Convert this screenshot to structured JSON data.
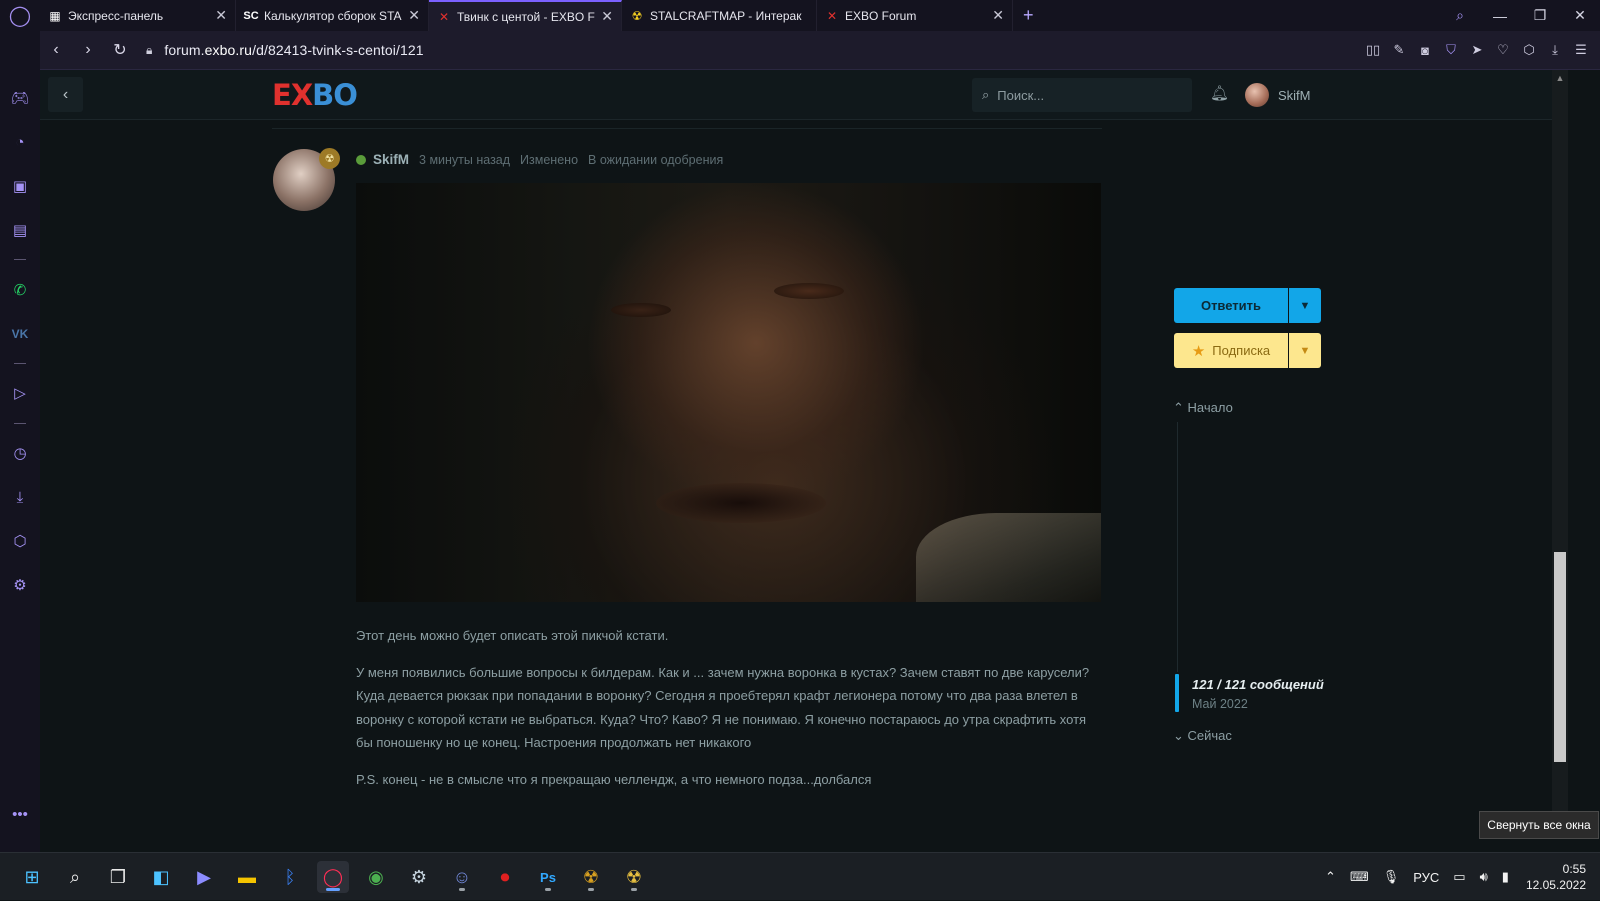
{
  "tabs": [
    {
      "title": "Экспресс-панель",
      "icon": "grid-icon",
      "active": false
    },
    {
      "title": "Калькулятор сборок STALC",
      "icon": "sc-icon",
      "active": false
    },
    {
      "title": "Твинк с центой - EXBO For",
      "icon": "exbo-icon",
      "active": true
    },
    {
      "title": "STALCRAFTMAP - Интерак",
      "icon": "radiation-icon",
      "active": false
    },
    {
      "title": "EXBO Forum",
      "icon": "exbo-icon",
      "active": false
    }
  ],
  "address": {
    "url_prefix": "forum.",
    "url_host": "exbo.ru",
    "url_path": "/d/82413-tvink-s-centoi/121"
  },
  "header": {
    "logo_part1": "E",
    "logo_part2": "X",
    "logo_part3": "BO",
    "search_placeholder": "Поиск...",
    "user_name": "SkifM"
  },
  "post": {
    "author": "SkifM",
    "time": "3 минуты назад",
    "edited": "Изменено",
    "pending": "В ожидании одобрения",
    "paragraphs": [
      "Этот день можно будет описать этой пикчой кстати.",
      "У меня появились большие вопросы к билдерам. Как и ... зачем нужна воронка в кустах? Зачем ставят по две карусели? Куда девается рюкзак при попадании в воронку? Сегодня я проебтерял крафт легионера потому что два раза влетел в воронку с которой кстати не выбраться. Куда? Что? Каво? Я не понимаю. Я конечно постараюсь до утра скрафтить хотя бы поношенку но це конец. Настроения продолжать нет никакого",
      "P.S. конец - не в смысле что я прекращаю челлендж, а что немного подза...долбался"
    ]
  },
  "controls": {
    "reply_label": "Ответить",
    "subscribe_label": "Подписка",
    "start_label": "Начало",
    "count_label": "121 / 121 сообщений",
    "date_label": "Май 2022",
    "now_label": "Сейчас"
  },
  "tooltip": "Свернуть все окна",
  "tray": {
    "lang": "РУС",
    "time": "0:55",
    "date": "12.05.2022"
  },
  "colors": {
    "accent_blue": "#12a6e8",
    "subscribe_yellow": "#fde78e",
    "opera_purple": "#a593f5",
    "exbo_red": "#e0312e"
  }
}
